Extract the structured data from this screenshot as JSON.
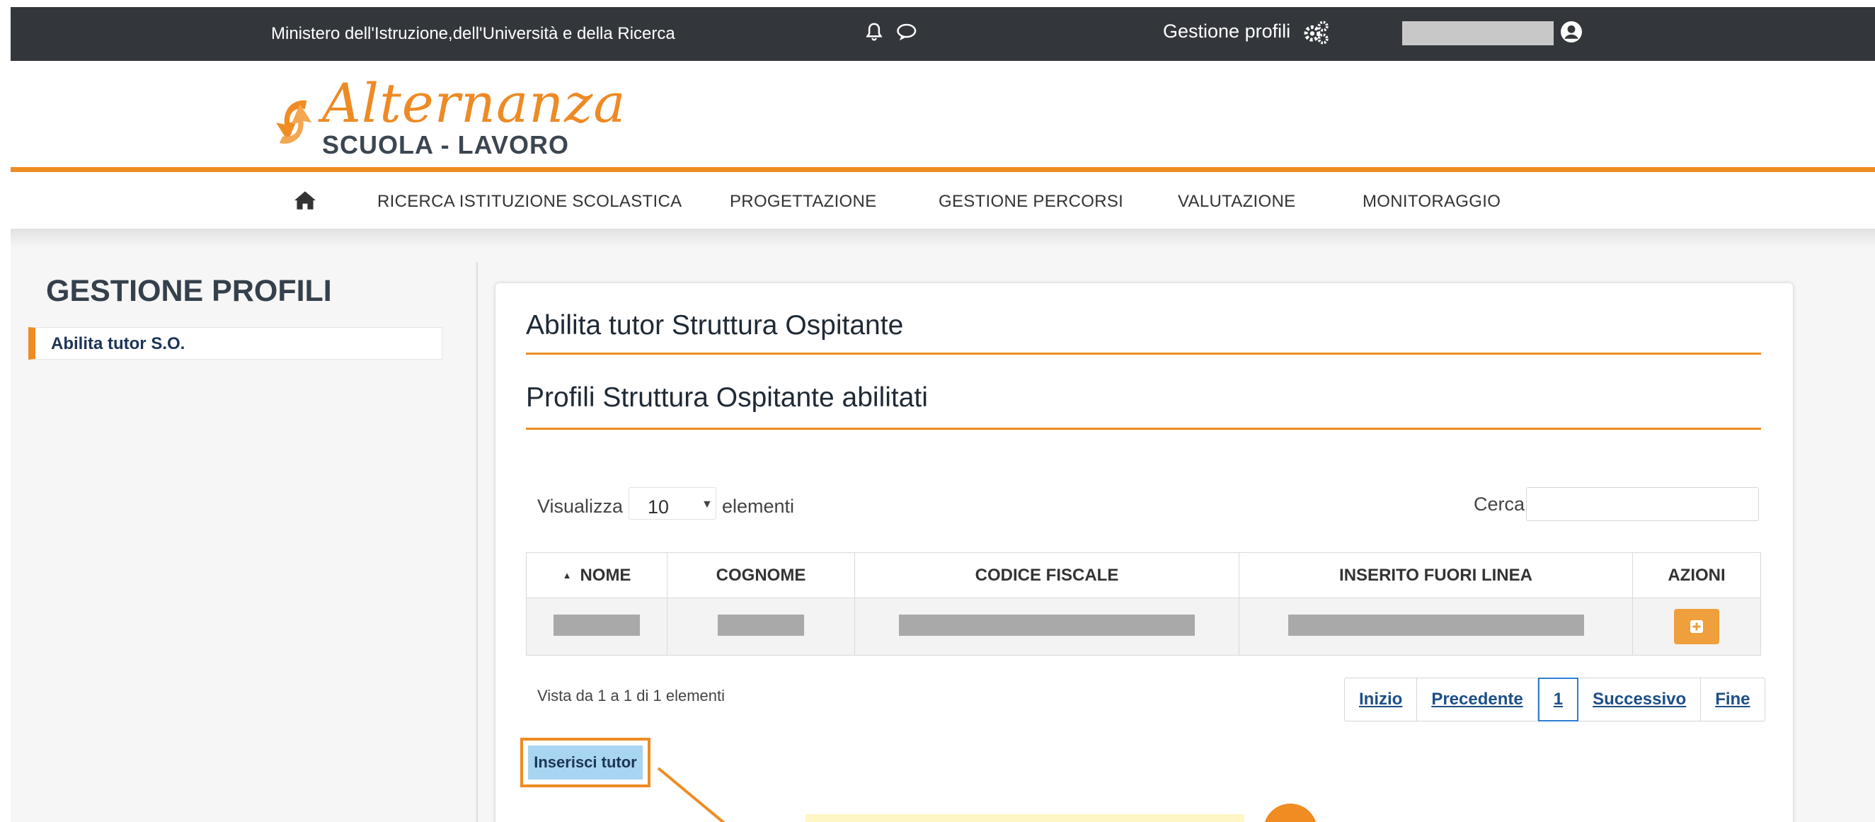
{
  "topbar": {
    "ministry": "Ministero dell'Istruzione,dell'Università e della Ricerca",
    "bell_icon": "bell-icon",
    "chat_icon": "chat-icon",
    "profile_management": "Gestione profili",
    "gears_icon": "gears-icon",
    "user_icon": "user-circle-icon"
  },
  "logo": {
    "main": "Alternanza",
    "sub": "SCUOLA - LAVORO"
  },
  "nav": {
    "home_icon": "home-icon",
    "items": [
      "RICERCA ISTITUZIONE SCOLASTICA",
      "PROGETTAZIONE",
      "GESTIONE PERCORSI",
      "VALUTAZIONE",
      "MONITORAGGIO"
    ]
  },
  "sidebar": {
    "title": "GESTIONE PROFILI",
    "items": [
      {
        "label": "Abilita tutor S.O.",
        "active": true
      }
    ]
  },
  "main": {
    "title": "Abilita tutor Struttura Ospitante",
    "subtitle": "Profili Struttura Ospitante abilitati",
    "length_label": "Visualizza",
    "length_value": "10",
    "length_suffix": "elementi",
    "search_label": "Cerca:",
    "search_value": "",
    "table": {
      "columns": [
        "NOME",
        "COGNOME",
        "CODICE FISCALE",
        "INSERITO FUORI LINEA",
        "AZIONI"
      ],
      "sorted_column": "NOME",
      "rows": [
        {
          "nome": "",
          "cognome": "",
          "codice_fiscale": "",
          "inserito_fuori_linea": "",
          "azione_icon": "plus-square-icon"
        }
      ]
    },
    "info": "Vista da 1 a 1 di 1 elementi",
    "pagination": [
      "Inizio",
      "Precedente",
      "1",
      "Successivo",
      "Fine"
    ],
    "current_page": "1",
    "insert_button": "Inserisci tutor"
  },
  "colors": {
    "accent": "#ef8c22",
    "topbar": "#33373c",
    "link": "#1d4f86",
    "button": "#a7d5f2"
  }
}
